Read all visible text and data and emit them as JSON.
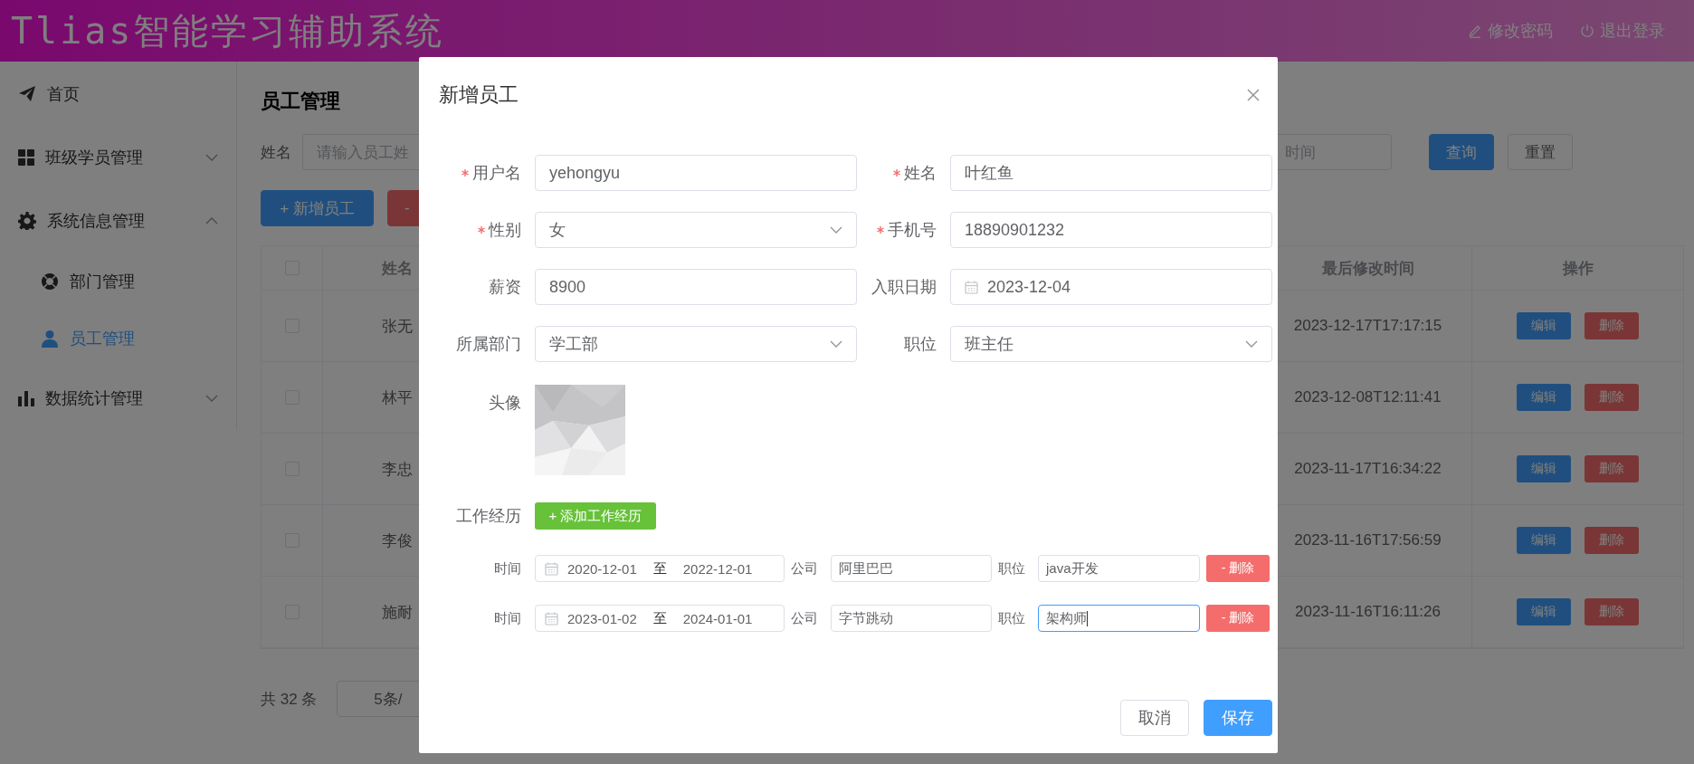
{
  "header": {
    "title": "Tlias智能学习辅助系统",
    "actions": [
      {
        "label": "修改密码",
        "kind": "edit"
      },
      {
        "label": "退出登录",
        "kind": "power"
      }
    ]
  },
  "sidebar": {
    "items": [
      {
        "label": "首页",
        "kind": "plane",
        "selected": false
      },
      {
        "label": "班级学员管理",
        "kind": "grid",
        "selected": false,
        "expanded": false
      },
      {
        "label": "系统信息管理",
        "kind": "gear",
        "selected": false,
        "expanded": true,
        "children": [
          {
            "label": "部门管理",
            "kind": "ring",
            "selected": false
          },
          {
            "label": "员工管理",
            "kind": "person",
            "selected": true
          }
        ]
      },
      {
        "label": "数据统计管理",
        "kind": "chart",
        "selected": false,
        "expanded": false
      }
    ]
  },
  "page": {
    "title": "员工管理",
    "search": {
      "name_label": "姓名",
      "name_placeholder": "请输入员工姓",
      "date_placeholder": "时间",
      "buttons": [
        {
          "label": "查询",
          "kind": "primary"
        },
        {
          "label": "重置",
          "kind": "default"
        }
      ]
    },
    "actions": [
      {
        "label": "+ 新增员工",
        "kind": "primary"
      },
      {
        "label": "-",
        "kind": "danger"
      }
    ],
    "table": {
      "select_all_checked": false,
      "columns": [
        "姓名",
        "最后修改时间",
        "操作"
      ],
      "rows": [
        {
          "checked": false,
          "name": "张无",
          "updated": "2023-12-17T17:17:15",
          "actions": [
            "编辑",
            "删除"
          ]
        },
        {
          "checked": false,
          "name": "林平",
          "updated": "2023-12-08T12:11:41",
          "actions": [
            "编辑",
            "删除"
          ]
        },
        {
          "checked": false,
          "name": "李忠",
          "updated": "2023-11-17T16:34:22",
          "actions": [
            "编辑",
            "删除"
          ]
        },
        {
          "checked": false,
          "name": "李俊",
          "updated": "2023-11-16T17:56:59",
          "actions": [
            "编辑",
            "删除"
          ]
        },
        {
          "checked": false,
          "name": "施耐",
          "updated": "2023-11-16T16:11:26",
          "actions": [
            "编辑",
            "删除"
          ]
        }
      ]
    },
    "pagination": {
      "total": "共 32 条",
      "page_size": "5条/"
    }
  },
  "dialog": {
    "title": "新增员工",
    "fields": [
      {
        "label": "用户名",
        "required": true,
        "kind": "text",
        "value": "yehongyu"
      },
      {
        "label": "姓名",
        "required": true,
        "kind": "text",
        "value": "叶红鱼"
      },
      {
        "label": "性别",
        "required": true,
        "kind": "select",
        "value": "女"
      },
      {
        "label": "手机号",
        "required": true,
        "kind": "text",
        "value": "18890901232"
      },
      {
        "label": "薪资",
        "required": false,
        "kind": "text",
        "value": "8900"
      },
      {
        "label": "入职日期",
        "required": false,
        "kind": "date",
        "value": "2023-12-04"
      },
      {
        "label": "所属部门",
        "required": false,
        "kind": "select",
        "value": "学工部"
      },
      {
        "label": "职位",
        "required": false,
        "kind": "select",
        "value": "班主任"
      }
    ],
    "avatar": {
      "label": "头像",
      "kind": "picture"
    },
    "experience": {
      "label": "工作经历",
      "add_button": "+ 添加工作经历",
      "rows": [
        {
          "time_label": "时间",
          "start": "2020-12-01",
          "separator": "至",
          "end": "2022-12-01",
          "company_label": "公司",
          "company": "阿里巴巴",
          "position_label": "职位",
          "position": "java开发",
          "focused": false,
          "delete_button": "- 删除"
        },
        {
          "time_label": "时间",
          "start": "2023-01-02",
          "separator": "至",
          "end": "2024-01-01",
          "company_label": "公司",
          "company": "字节跳动",
          "position_label": "职位",
          "position": "架构师",
          "focused": true,
          "delete_button": "- 删除"
        }
      ]
    },
    "buttons": [
      {
        "label": "取消",
        "kind": "default"
      },
      {
        "label": "保存",
        "kind": "primary"
      }
    ]
  }
}
